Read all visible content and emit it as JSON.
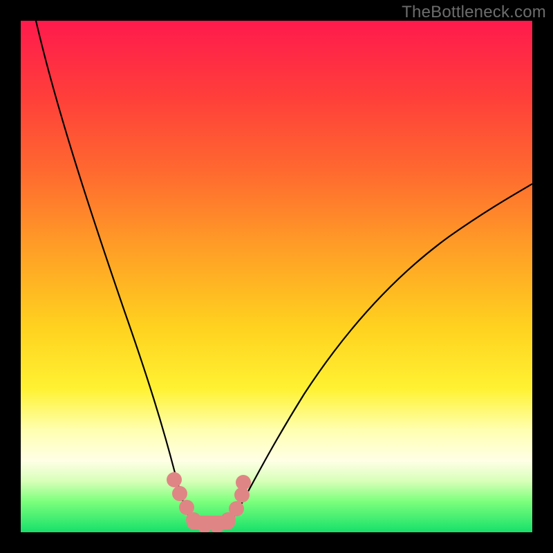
{
  "watermark": "TheBottleneck.com",
  "chart_data": {
    "type": "line",
    "title": "",
    "xlabel": "",
    "ylabel": "",
    "xlim": [
      0,
      100
    ],
    "ylim": [
      0,
      100
    ],
    "description": "Bottleneck curve with V-shaped minimum; background gradient green(low) to red(high).",
    "series": [
      {
        "name": "left-branch",
        "x": [
          2,
          5,
          8,
          11,
          14,
          17,
          20,
          22,
          24,
          26,
          27.5,
          29,
          30.5,
          31.5
        ],
        "y": [
          100,
          90,
          80,
          68,
          56,
          45,
          34,
          25,
          18,
          12,
          8,
          5,
          3,
          2
        ]
      },
      {
        "name": "right-branch",
        "x": [
          38,
          40,
          43,
          47,
          52,
          58,
          65,
          73,
          82,
          92,
          100
        ],
        "y": [
          2,
          4,
          8,
          14,
          21,
          29,
          37,
          45,
          52,
          58,
          62
        ]
      }
    ],
    "markers": {
      "name": "highlighted-range",
      "x": [
        28.5,
        30,
        31.5,
        33,
        34.5,
        36,
        37.5,
        38.5
      ],
      "y": [
        5,
        3,
        1.5,
        1,
        1,
        1.5,
        3,
        5
      ]
    },
    "annotations": []
  }
}
